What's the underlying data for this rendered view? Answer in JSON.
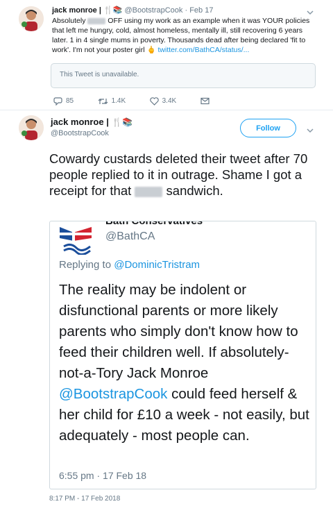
{
  "reply_tweet": {
    "display_name": "jack monroe |",
    "emoji": "🍴📚",
    "handle": "@BootstrapCook",
    "date": "Feb 17",
    "text_part1": "Absolutely",
    "text_part2": "OFF using my work as an example when it was YOUR policies that left me hungry, cold, almost homeless, mentally ill, still recovering 6 years later. 1 in 4 single mums in poverty. Thousands dead after being declared 'fit to work'. I'm not your poster girl",
    "emoji_end": "🖕",
    "link": "twitter.com/BathCA/status/...",
    "quoted_unavailable": "This Tweet is unavailable.",
    "replies": "85",
    "retweets": "1.4K",
    "likes": "3.4K"
  },
  "main_tweet": {
    "display_name": "jack monroe |",
    "emoji": "🍴📚",
    "handle": "@BootstrapCook",
    "follow_label": "Follow",
    "text_part1": "Cowardy custards deleted their tweet after 70 people replied to it in outrage. Shame I got a receipt for that",
    "text_part2": "sandwich.",
    "timestamp": "8:17 PM - 17 Feb 2018"
  },
  "embedded_tweet": {
    "account_name_partial": "Bath Conservatives",
    "handle": "@BathCA",
    "replying_label": "Replying to",
    "replying_to": "@DominicTristram",
    "body_part1": "The reality may be indolent or disfunctional parents or more likely parents who simply don't know how to feed their children well.  If absolutely-not-a-Tory Jack Monroe",
    "body_mention": "@BootstrapCook",
    "body_part2": "could feed herself & her child for £10 a week - not easily, but adequately - most people can.",
    "timestamp": "6:55 pm · 17 Feb 18"
  },
  "colors": {
    "accent": "#1da1f2",
    "link": "#1b95e0",
    "muted": "#657786"
  }
}
